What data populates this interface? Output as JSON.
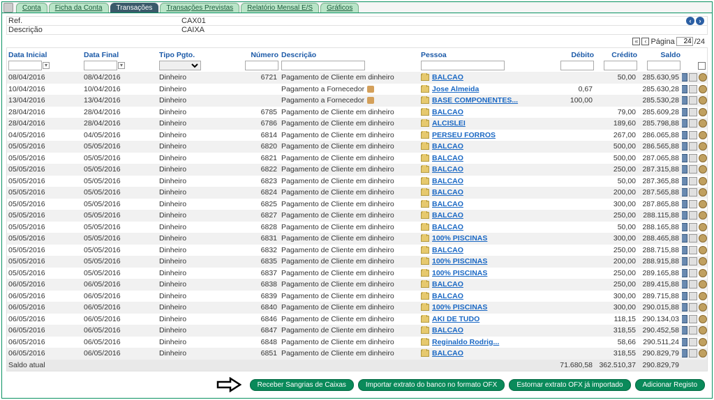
{
  "tabs": {
    "items": [
      "Conta",
      "Ficha da Conta",
      "Transações",
      "Transações Previstas",
      "Relatório Mensal E/S",
      "Gráficos"
    ],
    "active_index": 2
  },
  "header": {
    "ref_label": "Ref.",
    "ref_value": "CAX01",
    "desc_label": "Descrição",
    "desc_value": "CAIXA"
  },
  "pager": {
    "label": "Página",
    "current": "24",
    "total": "/24"
  },
  "columns": {
    "data_inicial": "Data Inicial",
    "data_final": "Data Final",
    "tipo_pgto": "Tipo Pgto.",
    "numero": "Número",
    "descricao": "Descrição",
    "pessoa": "Pessoa",
    "debito": "Débito",
    "credito": "Crédito",
    "saldo": "Saldo"
  },
  "rows": [
    {
      "di": "08/04/2016",
      "df": "08/04/2016",
      "tp": "Dinheiro",
      "num": "6721",
      "desc": "Pagamento de Cliente em dinheiro",
      "pessoa": "BALCAO",
      "deb": "",
      "cred": "50,00",
      "saldo": "285.630,95"
    },
    {
      "di": "10/04/2016",
      "df": "10/04/2016",
      "tp": "Dinheiro",
      "num": "",
      "desc": "Pagamento a Fornecedor",
      "pessoa": "Jose Almeida",
      "deb": "0,67",
      "cred": "",
      "saldo": "285.630,28",
      "sup": true
    },
    {
      "di": "13/04/2016",
      "df": "13/04/2016",
      "tp": "Dinheiro",
      "num": "",
      "desc": "Pagamento a Fornecedor",
      "pessoa": "BASE COMPONENTES...",
      "deb": "100,00",
      "cred": "",
      "saldo": "285.530,28",
      "sup": true
    },
    {
      "di": "28/04/2016",
      "df": "28/04/2016",
      "tp": "Dinheiro",
      "num": "6785",
      "desc": "Pagamento de Cliente em dinheiro",
      "pessoa": "BALCAO",
      "deb": "",
      "cred": "79,00",
      "saldo": "285.609,28"
    },
    {
      "di": "28/04/2016",
      "df": "28/04/2016",
      "tp": "Dinheiro",
      "num": "6786",
      "desc": "Pagamento de Cliente em dinheiro",
      "pessoa": "ALCISLEI",
      "deb": "",
      "cred": "189,60",
      "saldo": "285.798,88"
    },
    {
      "di": "04/05/2016",
      "df": "04/05/2016",
      "tp": "Dinheiro",
      "num": "6814",
      "desc": "Pagamento de Cliente em dinheiro",
      "pessoa": "PERSEU FORROS",
      "deb": "",
      "cred": "267,00",
      "saldo": "286.065,88"
    },
    {
      "di": "05/05/2016",
      "df": "05/05/2016",
      "tp": "Dinheiro",
      "num": "6820",
      "desc": "Pagamento de Cliente em dinheiro",
      "pessoa": "BALCAO",
      "deb": "",
      "cred": "500,00",
      "saldo": "286.565,88"
    },
    {
      "di": "05/05/2016",
      "df": "05/05/2016",
      "tp": "Dinheiro",
      "num": "6821",
      "desc": "Pagamento de Cliente em dinheiro",
      "pessoa": "BALCAO",
      "deb": "",
      "cred": "500,00",
      "saldo": "287.065,88"
    },
    {
      "di": "05/05/2016",
      "df": "05/05/2016",
      "tp": "Dinheiro",
      "num": "6822",
      "desc": "Pagamento de Cliente em dinheiro",
      "pessoa": "BALCAO",
      "deb": "",
      "cred": "250,00",
      "saldo": "287.315,88"
    },
    {
      "di": "05/05/2016",
      "df": "05/05/2016",
      "tp": "Dinheiro",
      "num": "6823",
      "desc": "Pagamento de Cliente em dinheiro",
      "pessoa": "BALCAO",
      "deb": "",
      "cred": "50,00",
      "saldo": "287.365,88"
    },
    {
      "di": "05/05/2016",
      "df": "05/05/2016",
      "tp": "Dinheiro",
      "num": "6824",
      "desc": "Pagamento de Cliente em dinheiro",
      "pessoa": "BALCAO",
      "deb": "",
      "cred": "200,00",
      "saldo": "287.565,88"
    },
    {
      "di": "05/05/2016",
      "df": "05/05/2016",
      "tp": "Dinheiro",
      "num": "6825",
      "desc": "Pagamento de Cliente em dinheiro",
      "pessoa": "BALCAO",
      "deb": "",
      "cred": "300,00",
      "saldo": "287.865,88"
    },
    {
      "di": "05/05/2016",
      "df": "05/05/2016",
      "tp": "Dinheiro",
      "num": "6827",
      "desc": "Pagamento de Cliente em dinheiro",
      "pessoa": "BALCAO",
      "deb": "",
      "cred": "250,00",
      "saldo": "288.115,88"
    },
    {
      "di": "05/05/2016",
      "df": "05/05/2016",
      "tp": "Dinheiro",
      "num": "6828",
      "desc": "Pagamento de Cliente em dinheiro",
      "pessoa": "BALCAO",
      "deb": "",
      "cred": "50,00",
      "saldo": "288.165,88"
    },
    {
      "di": "05/05/2016",
      "df": "05/05/2016",
      "tp": "Dinheiro",
      "num": "6831",
      "desc": "Pagamento de Cliente em dinheiro",
      "pessoa": "100% PISCINAS",
      "deb": "",
      "cred": "300,00",
      "saldo": "288.465,88"
    },
    {
      "di": "05/05/2016",
      "df": "05/05/2016",
      "tp": "Dinheiro",
      "num": "6832",
      "desc": "Pagamento de Cliente em dinheiro",
      "pessoa": "BALCAO",
      "deb": "",
      "cred": "250,00",
      "saldo": "288.715,88"
    },
    {
      "di": "05/05/2016",
      "df": "05/05/2016",
      "tp": "Dinheiro",
      "num": "6835",
      "desc": "Pagamento de Cliente em dinheiro",
      "pessoa": "100% PISCINAS",
      "deb": "",
      "cred": "200,00",
      "saldo": "288.915,88"
    },
    {
      "di": "05/05/2016",
      "df": "05/05/2016",
      "tp": "Dinheiro",
      "num": "6837",
      "desc": "Pagamento de Cliente em dinheiro",
      "pessoa": "100% PISCINAS",
      "deb": "",
      "cred": "250,00",
      "saldo": "289.165,88"
    },
    {
      "di": "06/05/2016",
      "df": "06/05/2016",
      "tp": "Dinheiro",
      "num": "6838",
      "desc": "Pagamento de Cliente em dinheiro",
      "pessoa": "BALCAO",
      "deb": "",
      "cred": "250,00",
      "saldo": "289.415,88"
    },
    {
      "di": "06/05/2016",
      "df": "06/05/2016",
      "tp": "Dinheiro",
      "num": "6839",
      "desc": "Pagamento de Cliente em dinheiro",
      "pessoa": "BALCAO",
      "deb": "",
      "cred": "300,00",
      "saldo": "289.715,88"
    },
    {
      "di": "06/05/2016",
      "df": "06/05/2016",
      "tp": "Dinheiro",
      "num": "6840",
      "desc": "Pagamento de Cliente em dinheiro",
      "pessoa": "100% PISCINAS",
      "deb": "",
      "cred": "300,00",
      "saldo": "290.015,88"
    },
    {
      "di": "06/05/2016",
      "df": "06/05/2016",
      "tp": "Dinheiro",
      "num": "6846",
      "desc": "Pagamento de Cliente em dinheiro",
      "pessoa": "AKI DE TUDO",
      "deb": "",
      "cred": "118,15",
      "saldo": "290.134,03"
    },
    {
      "di": "06/05/2016",
      "df": "06/05/2016",
      "tp": "Dinheiro",
      "num": "6847",
      "desc": "Pagamento de Cliente em dinheiro",
      "pessoa": "BALCAO",
      "deb": "",
      "cred": "318,55",
      "saldo": "290.452,58"
    },
    {
      "di": "06/05/2016",
      "df": "06/05/2016",
      "tp": "Dinheiro",
      "num": "6848",
      "desc": "Pagamento de Cliente em dinheiro",
      "pessoa": "Reginaldo Rodrig...",
      "deb": "",
      "cred": "58,66",
      "saldo": "290.511,24"
    },
    {
      "di": "06/05/2016",
      "df": "06/05/2016",
      "tp": "Dinheiro",
      "num": "6851",
      "desc": "Pagamento de Cliente em dinheiro",
      "pessoa": "BALCAO",
      "deb": "",
      "cred": "318,55",
      "saldo": "290.829,79"
    }
  ],
  "footer": {
    "label": "Saldo atual",
    "deb": "71.680,58",
    "cred": "362.510,37",
    "saldo": "290.829,79"
  },
  "buttons": {
    "b1": "Receber Sangrias de Caixas",
    "b2": "Importar extrato do banco no formato OFX",
    "b3": "Estornar extrato OFX já importado",
    "b4": "Adicionar Registo"
  }
}
